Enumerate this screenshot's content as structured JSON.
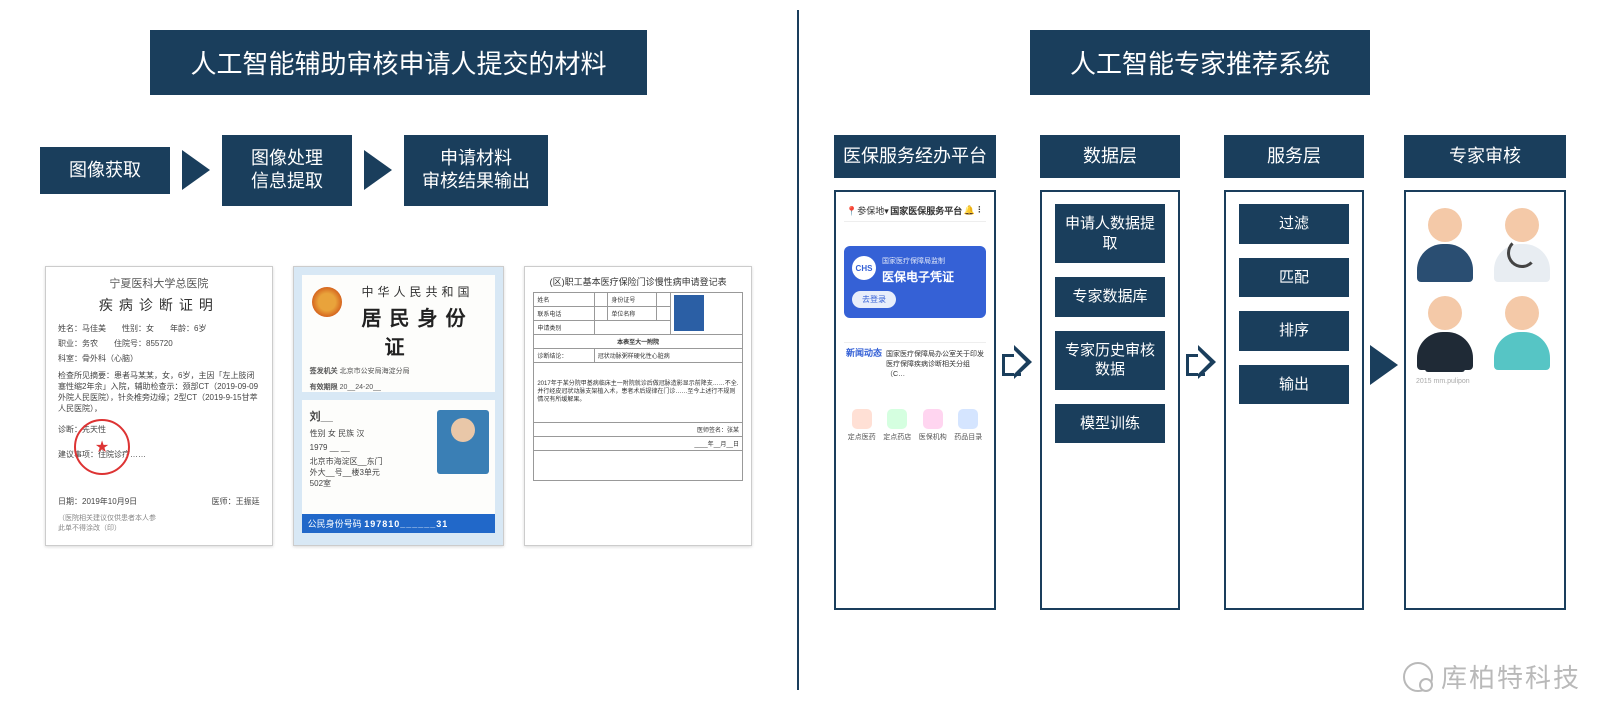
{
  "left": {
    "title": "人工智能辅助审核申请人提交的材料",
    "flow": {
      "step1": "图像获取",
      "step2": "图像处理\n信息提取",
      "step3": "申请材料\n审核结果输出"
    },
    "doc1": {
      "hospital": "宁夏医科大学总医院",
      "title": "疾病诊断证明",
      "l1": "姓名：马佳美　　性别：女　　年龄：6岁",
      "l2": "职业：务农　　住院号：855720",
      "l3": "科室：骨外科（心脑）",
      "diag": "检查所见摘要：患者马某某，女，6岁，主因「左上肢闭塞性缩2年余」入院，辅助检查示：颈部CT（2019-09-09外院人民医院），针灸椎旁边缘；2型CT（2019-9-15甘萃人民医院），",
      "note": "诊断：先天性",
      "adv": "建议事项：住院诊疗……",
      "date": "日期：2019年10月9日",
      "sign": "医师：王振廷",
      "foot1": "（医院相关建议仅供患者本人参",
      "foot2": "此单不得涂改（印）"
    },
    "doc2": {
      "l1": "中华人民共和国",
      "l2": "居民身份证",
      "issuer_label": "签发机关",
      "issuer": "北京市公安局海淀分局",
      "valid_label": "有效期限",
      "valid": "20__24-20__",
      "name": "刘__",
      "sex": "性别 女 民族 汉",
      "dob": "1979 __ __",
      "addr": "北京市海淀区__东门外大__号__楼3单元",
      "zip": "502室",
      "strip_label": "公民身份号码",
      "strip_num": "197810______31"
    },
    "doc3": {
      "title": "(区)职工基本医疗保险门诊慢性病申请登记表",
      "r1": "姓名",
      "r2": "身份证号",
      "r3": "联系电话",
      "r4": "单位名称",
      "r5": "申请类别",
      "sect": "本表至大一附院",
      "diag_label": "诊断结论：",
      "diag": "冠状动脉粥样硬化性心脏病",
      "desc": "2017年于某分院甲基病临床主一附院就诊后做冠脉造影显示前降支……不全.并行经皮冠状动脉支架植入术，患者术后规律在门诊……至今上述行不规则情况有所缓解果。",
      "sig": "医师签名：张某",
      "date": "____年__月__日"
    }
  },
  "right": {
    "title": "人工智能专家推荐系统",
    "cols": {
      "platform": "医保服务经办平台",
      "data": "数据层",
      "service": "服务层",
      "expert": "专家审核"
    },
    "platform": {
      "loc": "参保地",
      "header": "国家医保服务平台",
      "card_sub": "国家医疗保障局监制",
      "card_title": "医保电子凭证",
      "card_btn": "去登录",
      "news_tag": "新闻动态",
      "news": "国家医疗保障局办公室关于印发医疗保障疾病诊断相关分组（C…",
      "icons": {
        "i1": "定点医药",
        "i2": "定点药店",
        "i3": "医保机构",
        "i4": "药品目录"
      }
    },
    "data_nodes": {
      "n1": "申请人数据提取",
      "n2": "专家数据库",
      "n3": "专家历史审核数据",
      "n4": "模型训练"
    },
    "service_nodes": {
      "n1": "过滤",
      "n2": "匹配",
      "n3": "排序",
      "n4": "输出"
    },
    "experts_tag": "2015 mm.pulipon"
  },
  "watermark": "库柏特科技"
}
